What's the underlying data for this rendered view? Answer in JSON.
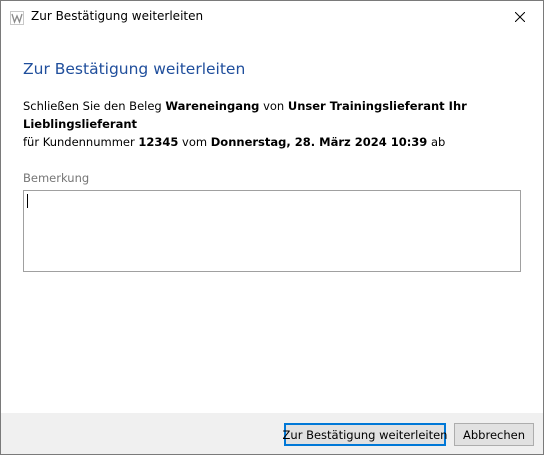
{
  "window": {
    "title": "Zur Bestätigung weiterleiten",
    "app_icon": "app-icon",
    "close_icon": "close-icon"
  },
  "dialog": {
    "heading": "Zur Bestätigung weiterleiten",
    "message": {
      "p1": "Schließen Sie den Beleg ",
      "doc_type": "Wareneingang",
      "p2": " von ",
      "supplier": "Unser Trainingslieferant Ihr Lieblingslieferant",
      "p3": "für Kundennummer ",
      "customer_number": "12345",
      "p4": " vom ",
      "date": "Donnerstag, 28. März 2024 10:39",
      "p5": " ab"
    },
    "remark": {
      "label": "Bemerkung",
      "value": ""
    }
  },
  "footer": {
    "confirm_label": "Zur Bestätigung weiterleiten",
    "cancel_label": "Abbrechen"
  },
  "colors": {
    "heading": "#1f4e9c",
    "footer_bg": "#f0f0f0",
    "primary_border": "#0078d7"
  }
}
